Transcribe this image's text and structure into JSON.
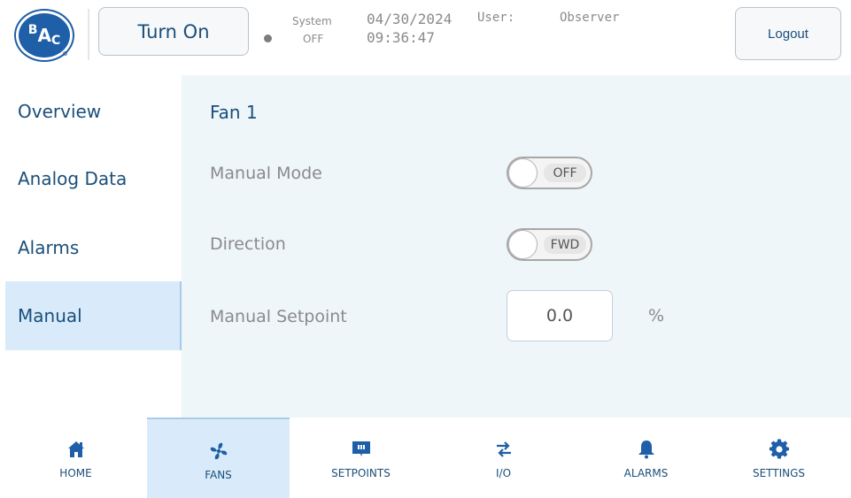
{
  "header": {
    "logo_text": "BAC",
    "turn_on_label": "Turn On",
    "system_label": "System",
    "system_value": "OFF",
    "date": "04/30/2024",
    "time": "09:36:47",
    "user_label": "User:",
    "user_value": "Observer",
    "logout_label": "Logout"
  },
  "sidebar": {
    "items": [
      {
        "label": "Overview"
      },
      {
        "label": "Analog Data"
      },
      {
        "label": "Alarms"
      },
      {
        "label": "Manual",
        "active": true
      }
    ]
  },
  "main": {
    "title": "Fan 1",
    "manual_mode_label": "Manual Mode",
    "manual_mode_value": "OFF",
    "direction_label": "Direction",
    "direction_value": "FWD",
    "setpoint_label": "Manual Setpoint",
    "setpoint_value": "0.0",
    "setpoint_unit": "%"
  },
  "bottom_nav": {
    "items": [
      {
        "label": "HOME",
        "icon": "home-icon"
      },
      {
        "label": "FANS",
        "icon": "fan-icon",
        "active": true
      },
      {
        "label": "SETPOINTS",
        "icon": "setpoints-icon"
      },
      {
        "label": "I/O",
        "icon": "io-arrows-icon"
      },
      {
        "label": "ALARMS",
        "icon": "bell-icon"
      },
      {
        "label": "SETTINGS",
        "icon": "gear-icon"
      }
    ]
  },
  "colors": {
    "primary_text": "#1a4f7a",
    "accent_blue": "#1f5fa8",
    "active_bg": "#d9ebfb",
    "panel_bg": "#eef6fa",
    "muted_text": "#8a8a8a"
  }
}
